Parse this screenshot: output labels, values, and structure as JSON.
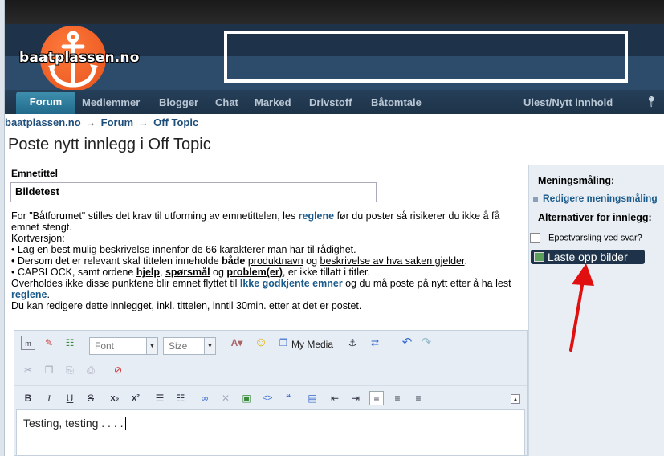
{
  "logo": {
    "text": "baatplassen.no"
  },
  "nav": {
    "active_tab": "Forum",
    "items": [
      "Medlemmer",
      "Blogger",
      "Chat",
      "Marked",
      "Drivstoff",
      "Båtomtale"
    ],
    "right_item": "Ulest/Nytt innhold"
  },
  "breadcrumb": {
    "items": [
      "baatplassen.no",
      "Forum",
      "Off Topic"
    ],
    "separator": "→"
  },
  "page_title": "Poste nytt innlegg i Off Topic",
  "form": {
    "subject_label": "Emnetittel",
    "subject_value": "Bildetest",
    "rules": {
      "l1a": "For \"Båtforumet\" stilles det krav til utforming av emnetittelen, les ",
      "l1link": "reglene",
      "l1b": " før du poster så risikerer du ikke å få emnet stengt.",
      "l2": "Kortversjon:",
      "b1": "• Lag en best mulig beskrivelse innenfor de 66 karakterer man har til rådighet.",
      "b2a": "• Dersom det er relevant skal tittelen inneholde ",
      "b2bold": "både",
      "b2u1": "produktnavn",
      "b2og": " og ",
      "b2u2": "beskrivelse av hva saken gjelder",
      "b2end": ".",
      "b3a": "• CAPSLOCK, samt ordene ",
      "b3w1": "hjelp",
      "b3w2": "spørsmål",
      "b3og": " og ",
      "b3w3": "problem(er)",
      "b3end": ", er ikke tillatt i titler.",
      "l3a": "Overholdes ikke disse punktene blir emnet flyttet til ",
      "l3link": "Ikke godkjente emner",
      "l3b": " og du må poste på nytt etter å ha lest ",
      "l3link2": "reglene",
      "l3end": ".",
      "l4": "Du kan redigere dette innlegget, inkl. tittelen, inntil 30min. etter at det er postet."
    }
  },
  "editor": {
    "font_placeholder": "Font",
    "size_placeholder": "Size",
    "my_media_label": "My Media",
    "body_text": "Testing, testing . . . ."
  },
  "sidebar": {
    "poll_heading": "Meningsmåling:",
    "poll_link": "Redigere meningsmåling",
    "options_heading": "Alternativer for innlegg:",
    "email_notify_label": "Epostvarsling ved svar?",
    "upload_label": "Laste opp bilder"
  },
  "colors": {
    "header": "#1e3349",
    "link": "#1a5a8a",
    "arrow": "#e01010"
  }
}
